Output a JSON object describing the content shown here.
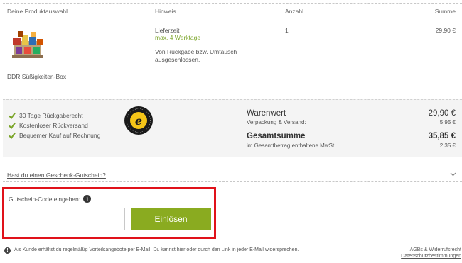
{
  "table_header": {
    "product": "Deine Produktauswahl",
    "hint": "Hinweis",
    "quantity": "Anzahl",
    "sum": "Summe"
  },
  "product": {
    "name": "DDR Süßigkeiten-Box",
    "delivery_label": "Lieferzeit",
    "delivery_value": "max. 4 Werktage",
    "return_note": "Von Rückgabe bzw. Umtausch ausgeschlossen.",
    "quantity": "1",
    "price": "29,90 €"
  },
  "benefits": [
    "30 Tage Rückgaberecht",
    "Kostenloser Rückversand",
    "Bequemer Kauf auf Rechnung"
  ],
  "summary": {
    "goods_label": "Warenwert",
    "goods_value": "29,90 €",
    "shipping_label": "Verpackung & Versand:",
    "shipping_value": "5,95 €",
    "total_label": "Gesamtsumme",
    "total_value": "35,85 €",
    "vat_label": "im Gesamtbetrag enthaltene MwSt.",
    "vat_value": "2,35 €"
  },
  "gift": {
    "link": "Hast du einen Geschenk-Gutschein?"
  },
  "coupon": {
    "label": "Gutschein-Code eingeben:",
    "input_value": "",
    "button": "Einlösen"
  },
  "footer": {
    "note_before": "Als Kunde erhältst du regelmäßig Vorteilsangebote per E-Mail. Du kannst ",
    "note_link": "hier",
    "note_after": " oder durch den Link in jeder E-Mail widersprechen.",
    "agb_link": "AGBs & Widerrufsrecht",
    "privacy_link": "Datenschutzbestimmungen"
  },
  "colors": {
    "accent_green": "#8aab20",
    "highlight_red": "#e0121a",
    "summary_bg": "#f4f4f4"
  },
  "icons": {
    "benefit": "check-icon",
    "badge": "trusted-shops-badge",
    "info": "info-icon",
    "chevron": "chevron-down-icon",
    "footer": "alert-icon"
  }
}
